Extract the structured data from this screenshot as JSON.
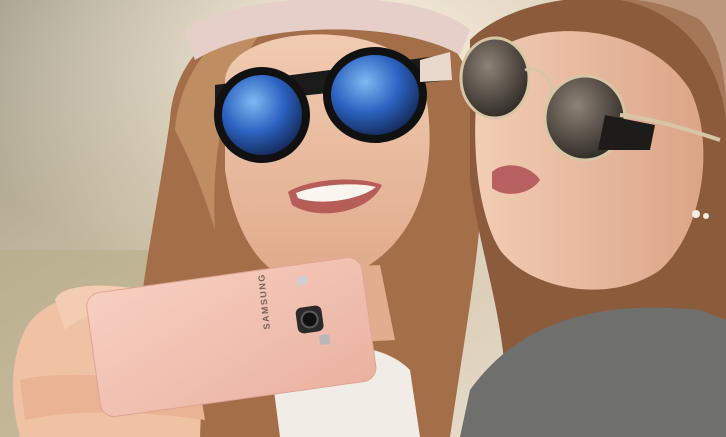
{
  "scene": {
    "description_label": "selfie-photo",
    "phone": {
      "brand": "SAMSUNG",
      "color": "#f2c3b3"
    },
    "colors": {
      "background_light": "#e7dccb",
      "background_dark": "#8d8a7a",
      "hair_left": "#a36d45",
      "hair_right": "#8a5a3a",
      "skin": "#e7b79a",
      "lens_blue": "#2f6fc9",
      "sweater": "#6f6f6d",
      "shirt": "#f1ece6"
    }
  }
}
